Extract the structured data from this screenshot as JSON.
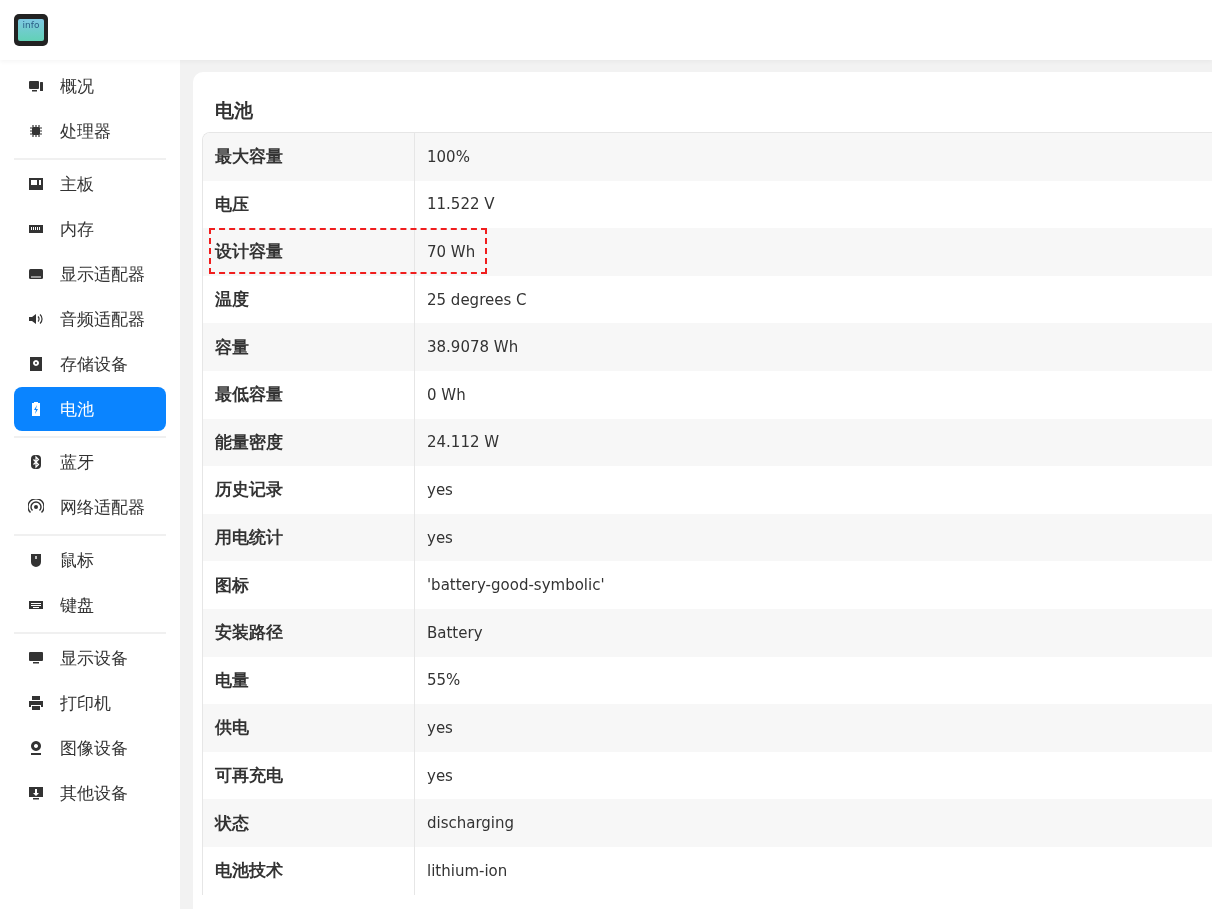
{
  "app": {
    "logo_text": "info"
  },
  "sidebar": {
    "groups": [
      [
        {
          "label": "概况",
          "selected": false
        },
        {
          "label": "处理器",
          "selected": false
        }
      ],
      [
        {
          "label": "主板",
          "selected": false
        },
        {
          "label": "内存",
          "selected": false
        },
        {
          "label": "显示适配器",
          "selected": false
        },
        {
          "label": "音频适配器",
          "selected": false
        },
        {
          "label": "存储设备",
          "selected": false
        },
        {
          "label": "电池",
          "selected": true
        }
      ],
      [
        {
          "label": "蓝牙",
          "selected": false
        },
        {
          "label": "网络适配器",
          "selected": false
        }
      ],
      [
        {
          "label": "鼠标",
          "selected": false
        },
        {
          "label": "键盘",
          "selected": false
        }
      ],
      [
        {
          "label": "显示设备",
          "selected": false
        },
        {
          "label": "打印机",
          "selected": false
        },
        {
          "label": "图像设备",
          "selected": false
        },
        {
          "label": "其他设备",
          "selected": false
        }
      ]
    ]
  },
  "panel": {
    "title": "电池",
    "rows": [
      {
        "name": "最大容量",
        "value": "100%",
        "annotated": false
      },
      {
        "name": "电压",
        "value": "11.522 V",
        "annotated": false
      },
      {
        "name": "设计容量",
        "value": "70 Wh",
        "annotated": true
      },
      {
        "name": "温度",
        "value": "25 degrees C",
        "annotated": false
      },
      {
        "name": "容量",
        "value": "38.9078 Wh",
        "annotated": false
      },
      {
        "name": "最低容量",
        "value": "0 Wh",
        "annotated": false
      },
      {
        "name": "能量密度",
        "value": "24.112 W",
        "annotated": false
      },
      {
        "name": "历史记录",
        "value": "yes",
        "annotated": false
      },
      {
        "name": "用电统计",
        "value": "yes",
        "annotated": false
      },
      {
        "name": "图标",
        "value": "'battery-good-symbolic'",
        "annotated": false
      },
      {
        "name": "安装路径",
        "value": "Battery",
        "annotated": false
      },
      {
        "name": "电量",
        "value": "55%",
        "annotated": false
      },
      {
        "name": "供电",
        "value": "yes",
        "annotated": false
      },
      {
        "name": "可再充电",
        "value": "yes",
        "annotated": false
      },
      {
        "name": "状态",
        "value": "discharging",
        "annotated": false
      },
      {
        "name": "电池技术",
        "value": "lithium-ion",
        "annotated": false
      }
    ]
  }
}
